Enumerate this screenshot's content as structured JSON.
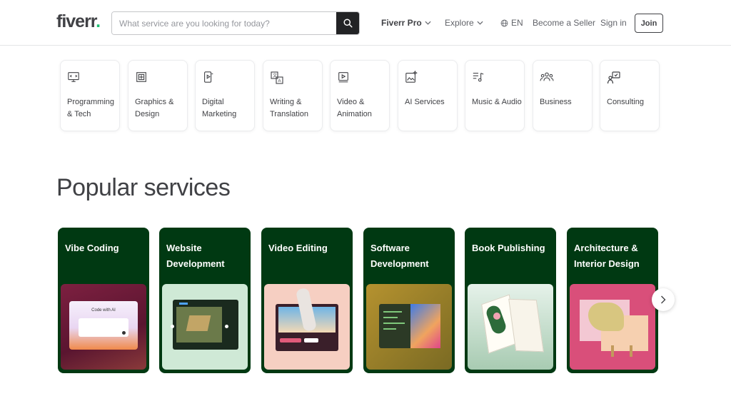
{
  "header": {
    "logo_text": "fiverr",
    "logo_dot": ".",
    "search_placeholder": "What service are you looking for today?",
    "nav": {
      "fiverr_pro": "Fiverr Pro",
      "explore": "Explore",
      "language": "EN",
      "become_seller": "Become a Seller",
      "sign_in": "Sign in",
      "join": "Join"
    }
  },
  "categories": [
    {
      "label": "Programming & Tech",
      "icon": "monitor-code-icon"
    },
    {
      "label": "Graphics & Design",
      "icon": "design-frame-icon"
    },
    {
      "label": "Digital Marketing",
      "icon": "phone-marketing-icon"
    },
    {
      "label": "Writing & Translation",
      "icon": "translate-icon"
    },
    {
      "label": "Video & Animation",
      "icon": "video-play-icon"
    },
    {
      "label": "AI Services",
      "icon": "ai-image-icon"
    },
    {
      "label": "Music & Audio",
      "icon": "music-note-icon"
    },
    {
      "label": "Business",
      "icon": "people-group-icon"
    },
    {
      "label": "Consulting",
      "icon": "consulting-icon"
    }
  ],
  "popular": {
    "title": "Popular services",
    "services": [
      {
        "title": "Vibe Coding",
        "image_text": "Code with AI"
      },
      {
        "title": "Website Development"
      },
      {
        "title": "Video Editing"
      },
      {
        "title": "Software Development"
      },
      {
        "title": "Book Publishing"
      },
      {
        "title": "Architecture & Interior Design"
      }
    ]
  },
  "colors": {
    "brand_green": "#1dbf73",
    "card_green": "#003912",
    "text_dark": "#404145"
  }
}
